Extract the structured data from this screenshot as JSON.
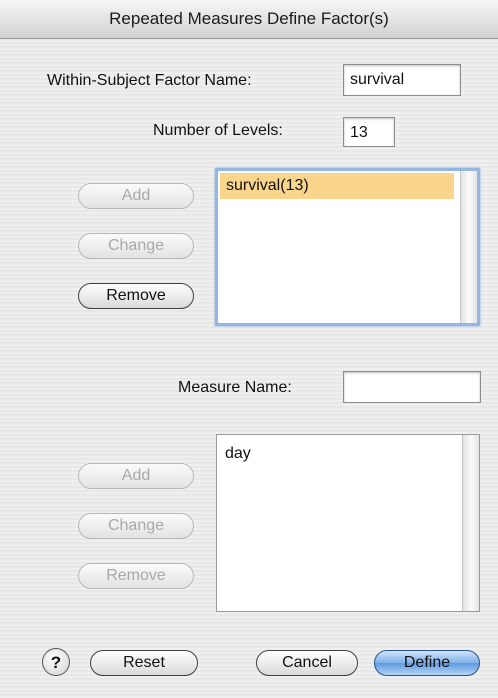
{
  "window": {
    "title": "Repeated Measures Define Factor(s)"
  },
  "factor": {
    "name_label": "Within-Subject Factor Name:",
    "name_value": "survival",
    "levels_label": "Number of Levels:",
    "levels_value": "13",
    "buttons": {
      "add": "Add",
      "change": "Change",
      "remove": "Remove"
    },
    "list": [
      "survival(13)"
    ]
  },
  "measure": {
    "name_label": "Measure Name:",
    "name_value": "",
    "buttons": {
      "add": "Add",
      "change": "Change",
      "remove": "Remove"
    },
    "list": [
      "day"
    ]
  },
  "footer": {
    "help_icon": "?",
    "reset": "Reset",
    "cancel": "Cancel",
    "define": "Define"
  },
  "colors": {
    "selection": "#fbd58b",
    "default_button": "#5f9ae0",
    "focus_ring": "#93b6e2"
  }
}
